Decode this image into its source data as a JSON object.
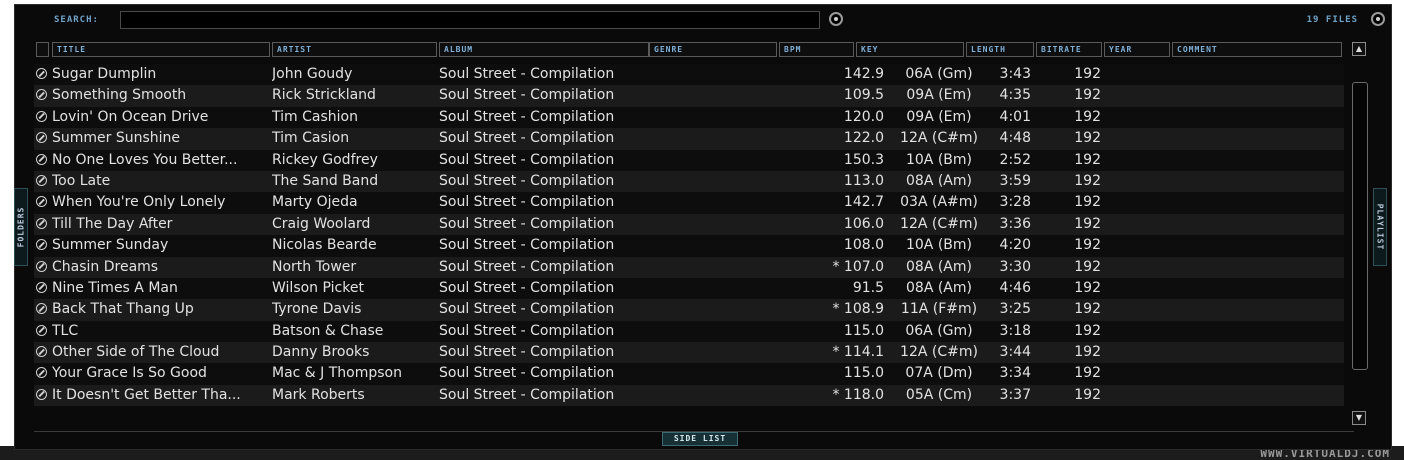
{
  "search": {
    "label": "SEARCH:",
    "value": "",
    "files_count": "19 FILES"
  },
  "columns": [
    "TITLE",
    "ARTIST",
    "ALBUM",
    "GENRE",
    "BPM",
    "KEY",
    "LENGTH",
    "BITRATE",
    "YEAR",
    "COMMENT"
  ],
  "side_tabs": {
    "left": "FOLDERS",
    "right": "PLAYLIST"
  },
  "bottom": {
    "side_list_label": "SIDE LIST",
    "watermark": "WWW.VIRTUALDJ.COM"
  },
  "scroll": {
    "up_icon": "▲",
    "down_icon": "▼"
  },
  "rows": [
    {
      "title": "Sugar Dumplin",
      "artist": "John Goudy",
      "album": "Soul Street - Compilation",
      "genre": "",
      "bpm": "142.9",
      "key": "06A (Gm)",
      "length": "3:43",
      "bitrate": "192",
      "year": "",
      "comment": ""
    },
    {
      "title": "Something Smooth",
      "artist": "Rick Strickland",
      "album": "Soul Street - Compilation",
      "genre": "",
      "bpm": "109.5",
      "key": "09A (Em)",
      "length": "4:35",
      "bitrate": "192",
      "year": "",
      "comment": ""
    },
    {
      "title": "Lovin' On Ocean Drive",
      "artist": "Tim Cashion",
      "album": "Soul Street - Compilation",
      "genre": "",
      "bpm": "120.0",
      "key": "09A (Em)",
      "length": "4:01",
      "bitrate": "192",
      "year": "",
      "comment": ""
    },
    {
      "title": "Summer Sunshine",
      "artist": "Tim Casion",
      "album": "Soul Street - Compilation",
      "genre": "",
      "bpm": "122.0",
      "key": "12A (C#m)",
      "length": "4:48",
      "bitrate": "192",
      "year": "",
      "comment": ""
    },
    {
      "title": "No One Loves You Better...",
      "artist": "Rickey Godfrey",
      "album": "Soul Street - Compilation",
      "genre": "",
      "bpm": "150.3",
      "key": "10A (Bm)",
      "length": "2:52",
      "bitrate": "192",
      "year": "",
      "comment": ""
    },
    {
      "title": "Too Late",
      "artist": "The Sand Band",
      "album": "Soul Street - Compilation",
      "genre": "",
      "bpm": "113.0",
      "key": "08A (Am)",
      "length": "3:59",
      "bitrate": "192",
      "year": "",
      "comment": ""
    },
    {
      "title": "When You're Only Lonely",
      "artist": "Marty Ojeda",
      "album": "Soul Street - Compilation",
      "genre": "",
      "bpm": "142.7",
      "key": "03A (A#m)",
      "length": "3:28",
      "bitrate": "192",
      "year": "",
      "comment": ""
    },
    {
      "title": "Till The Day After",
      "artist": "Craig Woolard",
      "album": "Soul Street - Compilation",
      "genre": "",
      "bpm": "106.0",
      "key": "12A (C#m)",
      "length": "3:36",
      "bitrate": "192",
      "year": "",
      "comment": ""
    },
    {
      "title": "Summer Sunday",
      "artist": "Nicolas Bearde",
      "album": "Soul Street - Compilation",
      "genre": "",
      "bpm": "108.0",
      "key": "10A (Bm)",
      "length": "4:20",
      "bitrate": "192",
      "year": "",
      "comment": ""
    },
    {
      "title": "Chasin Dreams",
      "artist": "North Tower",
      "album": "Soul Street - Compilation",
      "genre": "",
      "bpm": "* 107.0",
      "key": "08A (Am)",
      "length": "3:30",
      "bitrate": "192",
      "year": "",
      "comment": ""
    },
    {
      "title": "Nine Times A Man",
      "artist": "Wilson Picket",
      "album": "Soul Street - Compilation",
      "genre": "",
      "bpm": "91.5",
      "key": "08A (Am)",
      "length": "4:46",
      "bitrate": "192",
      "year": "",
      "comment": ""
    },
    {
      "title": "Back That Thang Up",
      "artist": "Tyrone Davis",
      "album": "Soul Street - Compilation",
      "genre": "",
      "bpm": "* 108.9",
      "key": "11A (F#m)",
      "length": "3:25",
      "bitrate": "192",
      "year": "",
      "comment": ""
    },
    {
      "title": "TLC",
      "artist": "Batson & Chase",
      "album": "Soul Street - Compilation",
      "genre": "",
      "bpm": "115.0",
      "key": "06A (Gm)",
      "length": "3:18",
      "bitrate": "192",
      "year": "",
      "comment": ""
    },
    {
      "title": "Other Side of The Cloud",
      "artist": "Danny Brooks",
      "album": "Soul Street - Compilation",
      "genre": "",
      "bpm": "* 114.1",
      "key": "12A (C#m)",
      "length": "3:44",
      "bitrate": "192",
      "year": "",
      "comment": ""
    },
    {
      "title": "Your Grace Is So Good",
      "artist": "Mac & J Thompson",
      "album": "Soul Street - Compilation",
      "genre": "",
      "bpm": "115.0",
      "key": "07A (Dm)",
      "length": "3:34",
      "bitrate": "192",
      "year": "",
      "comment": ""
    },
    {
      "title": "It Doesn't Get Better Tha...",
      "artist": "Mark Roberts",
      "album": "Soul Street - Compilation",
      "genre": "",
      "bpm": "* 118.0",
      "key": "05A (Cm)",
      "length": "3:37",
      "bitrate": "192",
      "year": "",
      "comment": ""
    }
  ]
}
